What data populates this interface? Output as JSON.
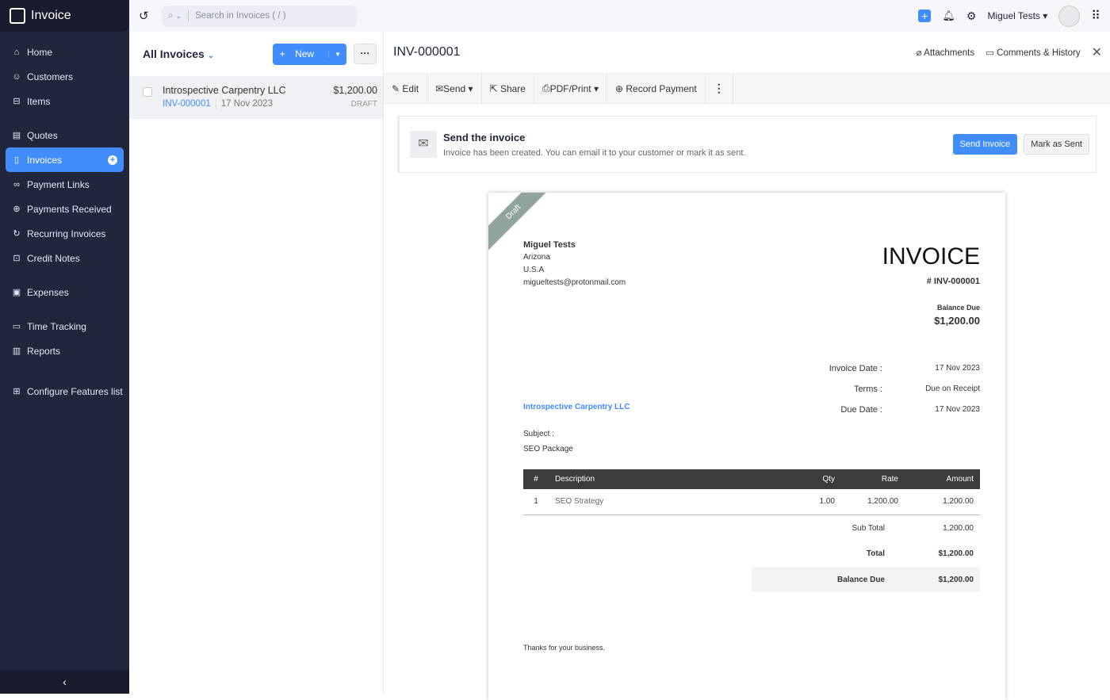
{
  "app": {
    "title": "Invoice"
  },
  "sidebar": {
    "items": [
      {
        "label": "Home",
        "icon": "home-icon"
      },
      {
        "label": "Customers",
        "icon": "user-icon"
      },
      {
        "label": "Items",
        "icon": "basket-icon"
      },
      {
        "label": "Quotes",
        "icon": "quote-icon"
      },
      {
        "label": "Invoices",
        "icon": "invoice-icon"
      },
      {
        "label": "Payment Links",
        "icon": "link-icon"
      },
      {
        "label": "Payments Received",
        "icon": "payment-icon"
      },
      {
        "label": "Recurring Invoices",
        "icon": "recurring-icon"
      },
      {
        "label": "Credit Notes",
        "icon": "credit-note-icon"
      },
      {
        "label": "Expenses",
        "icon": "expense-icon"
      },
      {
        "label": "Time Tracking",
        "icon": "calendar-icon"
      },
      {
        "label": "Reports",
        "icon": "chart-icon"
      },
      {
        "label": "Configure Features list",
        "icon": "grid-icon"
      }
    ]
  },
  "topbar": {
    "search_placeholder": "Search in Invoices ( / )",
    "user": "Miguel Tests"
  },
  "list": {
    "title": "All Invoices",
    "new_label": "New",
    "rows": [
      {
        "customer": "Introspective Carpentry LLC",
        "number": "INV-000001",
        "date": "17 Nov 2023",
        "amount": "$1,200.00",
        "status": "DRAFT"
      }
    ]
  },
  "detail": {
    "title": "INV-000001",
    "attachments": "Attachments",
    "comments": "Comments & History",
    "toolbar": {
      "edit": "Edit",
      "send": "Send",
      "share": "Share",
      "pdf": "PDF/Print",
      "record": "Record Payment"
    },
    "banner": {
      "heading": "Send the invoice",
      "text": "Invoice has been created. You can email it to your customer or mark it as sent.",
      "send": "Send Invoice",
      "mark": "Mark as Sent"
    }
  },
  "invoice": {
    "ribbon": "Draft",
    "from_name": "Miguel Tests",
    "from_state": "Arizona",
    "from_country": "U.S.A",
    "from_email": "migueltests@protonmail.com",
    "heading": "INVOICE",
    "number": "# INV-000001",
    "balance_label": "Balance Due",
    "balance": "$1,200.00",
    "date_label": "Invoice Date :",
    "date": "17 Nov 2023",
    "terms_label": "Terms :",
    "terms": "Due on Receipt",
    "due_label": "Due Date :",
    "due": "17 Nov 2023",
    "bill_to": "Introspective Carpentry LLC",
    "subject_label": "Subject :",
    "subject": "SEO Package",
    "columns": [
      "#",
      "Description",
      "Qty",
      "Rate",
      "Amount"
    ],
    "rows": [
      {
        "n": "1",
        "desc": "SEO Strategy",
        "qty": "1.00",
        "rate": "1,200.00",
        "amount": "1,200.00"
      }
    ],
    "subtotal_label": "Sub Total",
    "subtotal": "1,200.00",
    "total_label": "Total",
    "total": "$1,200.00",
    "balance_due_label": "Balance Due",
    "balance_due": "$1,200.00",
    "notes": "Thanks for your business."
  },
  "colors": {
    "accent": "#408dfb",
    "sidebar": "#21263c"
  }
}
